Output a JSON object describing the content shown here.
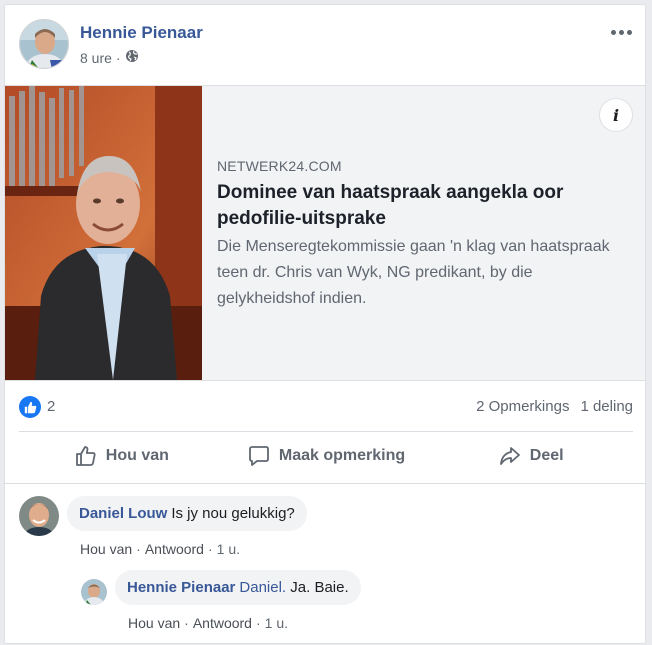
{
  "post": {
    "author": "Hennie Pienaar",
    "time": "8 ure",
    "separator": "·",
    "privacy_icon": "globe-icon",
    "more_icon": "more-dots-icon"
  },
  "link_preview": {
    "domain": "NETWERK24.COM",
    "title": "Dominee van haatspraak aangekla oor pedofilie-uitsprake",
    "description": "Die Menseregtekommissie gaan 'n klag van haatspraak teen dr. Chris van Wyk, NG predikant, by die gelykheidshof indien.",
    "info_label": "i"
  },
  "stats": {
    "like_count": "2",
    "comments": "2 Opmerkings",
    "shares": "1 deling"
  },
  "actions": {
    "like": "Hou van",
    "comment": "Maak opmerking",
    "share": "Deel"
  },
  "comments": [
    {
      "name": "Daniel Louw",
      "text": "Is jy nou gelukkig?",
      "like_label": "Hou van",
      "reply_label": "Antwoord",
      "separator": "·",
      "time": "1 u."
    },
    {
      "name": "Hennie Pienaar",
      "tag": "Daniel.",
      "text": "Ja. Baie.",
      "like_label": "Hou van",
      "reply_label": "Antwoord",
      "separator": "·",
      "time": "1 u."
    }
  ],
  "colors": {
    "link_blue": "#385898",
    "like_blue": "#1877f2",
    "muted": "#606770"
  }
}
